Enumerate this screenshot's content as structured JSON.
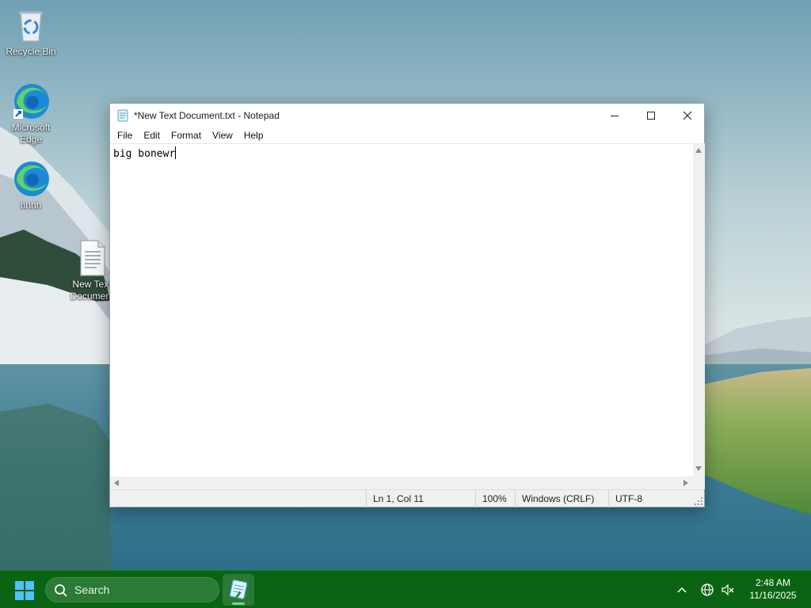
{
  "desktop": {
    "icons": [
      {
        "label": "Recycle Bin"
      },
      {
        "label": "Microsoft Edge"
      },
      {
        "label": "hhhh"
      },
      {
        "label": "New Text Document"
      }
    ]
  },
  "notepad": {
    "title": "*New Text Document.txt - Notepad",
    "menu": [
      "File",
      "Edit",
      "Format",
      "View",
      "Help"
    ],
    "content": "big bonewr",
    "status": {
      "position": "Ln 1, Col 11",
      "zoom": "100%",
      "line_ending": "Windows (CRLF)",
      "encoding": "UTF-8"
    }
  },
  "taskbar": {
    "search_label": "Search",
    "clock_time": "2:48 AM",
    "clock_date": "11/16/2025"
  },
  "colors": {
    "taskbar": "#0a6414",
    "accent": "#0078d4"
  }
}
